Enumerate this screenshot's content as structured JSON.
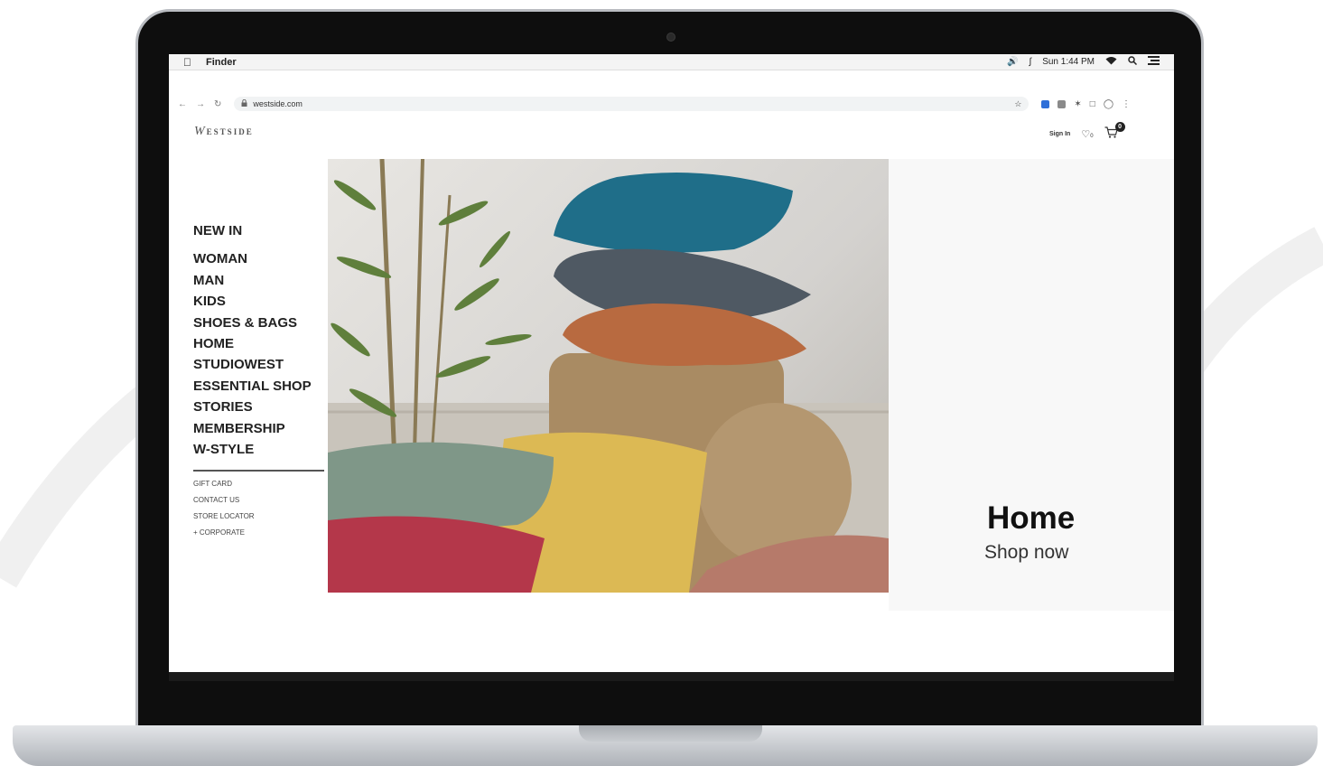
{
  "menubar": {
    "app_name": "Finder",
    "clock": "Sun 1:44 PM",
    "icons": [
      "apple-icon",
      "volume-icon",
      "bluetooth-icon",
      "wifi-icon",
      "spotlight-icon",
      "control-center-icon"
    ]
  },
  "browser": {
    "url": "westside.com",
    "nav_icons": [
      "back-icon",
      "forward-icon",
      "reload-icon",
      "lock-icon"
    ],
    "toolbar_icons": [
      "bookmark-star-icon",
      "extension-icon",
      "extension-icon",
      "puzzle-icon",
      "sidebar-icon",
      "profile-icon",
      "kebab-menu-icon"
    ]
  },
  "site": {
    "logo": {
      "initial": "W",
      "rest": "ESTSIDE"
    },
    "header": {
      "sign_in": "Sign In",
      "wishlist_count": "0",
      "cart_count": "0"
    },
    "main_nav": [
      "NEW IN",
      "WOMAN",
      "MAN",
      "KIDS",
      "SHOES & BAGS",
      "HOME",
      "STUDIOWEST",
      "ESSENTIAL SHOP",
      "STORIES",
      "MEMBERSHIP",
      "W-STYLE"
    ],
    "sub_nav": [
      "GIFT CARD",
      "CONTACT US",
      "STORE LOCATOR",
      "+ CORPORATE"
    ],
    "promo": {
      "title": "Home",
      "cta": "Shop now"
    }
  },
  "colors": {
    "text_dark": "#222222",
    "screen_bezel": "#0e0e0e",
    "aluminium": "#c9ccd0"
  }
}
